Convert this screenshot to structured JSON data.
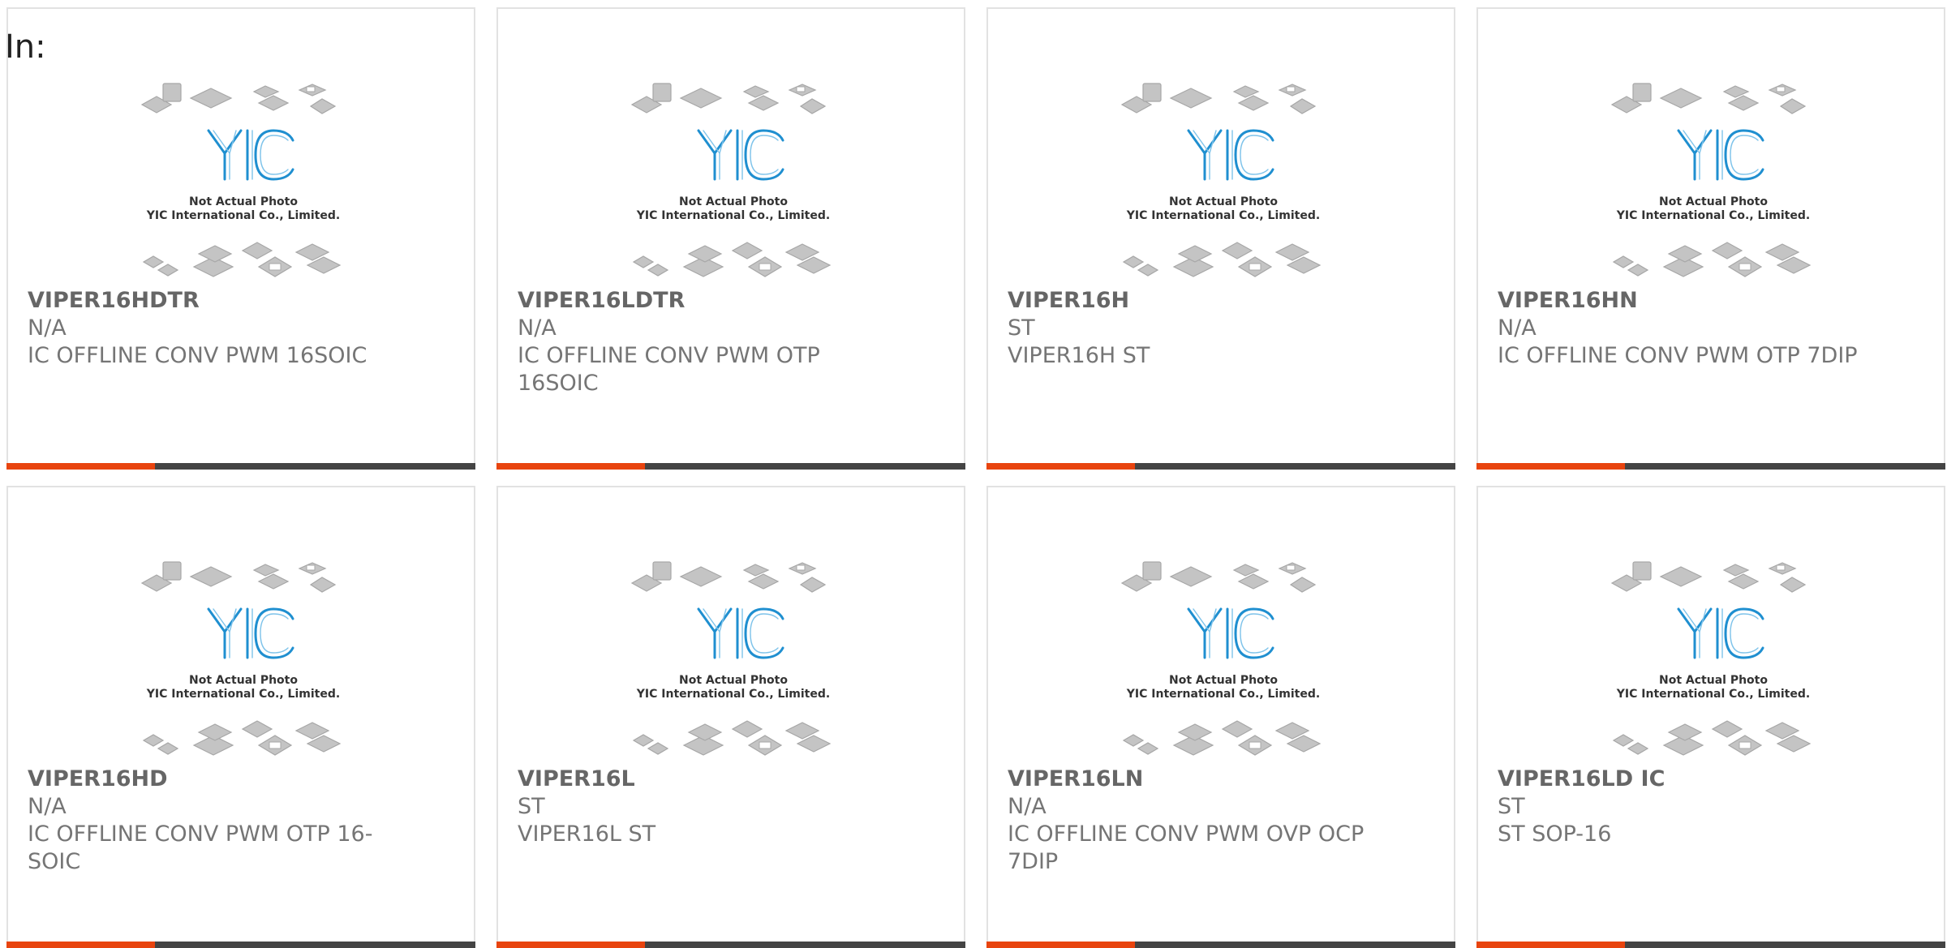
{
  "page": {
    "label": "In:"
  },
  "thumbnail": {
    "line1": "Not Actual Photo",
    "line2": "YIC International Co., Limited."
  },
  "colors": {
    "accent": "#e8440f",
    "bar": "#444444",
    "logo_blue": "#1f8fd0",
    "chip_gray": "#b9b9b9"
  },
  "products": [
    {
      "part": "VIPER16HDTR",
      "maker": "N/A",
      "description": "IC OFFLINE CONV PWM 16SOIC"
    },
    {
      "part": "VIPER16LDTR",
      "maker": "N/A",
      "description": "IC OFFLINE CONV PWM OTP 16SOIC"
    },
    {
      "part": "VIPER16H",
      "maker": "ST",
      "description": "VIPER16H ST"
    },
    {
      "part": "VIPER16HN",
      "maker": "N/A",
      "description": "IC OFFLINE CONV PWM OTP 7DIP"
    },
    {
      "part": "VIPER16HD",
      "maker": "N/A",
      "description": "IC OFFLINE CONV PWM OTP 16-SOIC"
    },
    {
      "part": "VIPER16L",
      "maker": "ST",
      "description": "VIPER16L ST"
    },
    {
      "part": "VIPER16LN",
      "maker": "N/A",
      "description": "IC OFFLINE CONV PWM OVP OCP 7DIP"
    },
    {
      "part": "VIPER16LD IC",
      "maker": "ST",
      "description": "ST SOP-16"
    }
  ]
}
